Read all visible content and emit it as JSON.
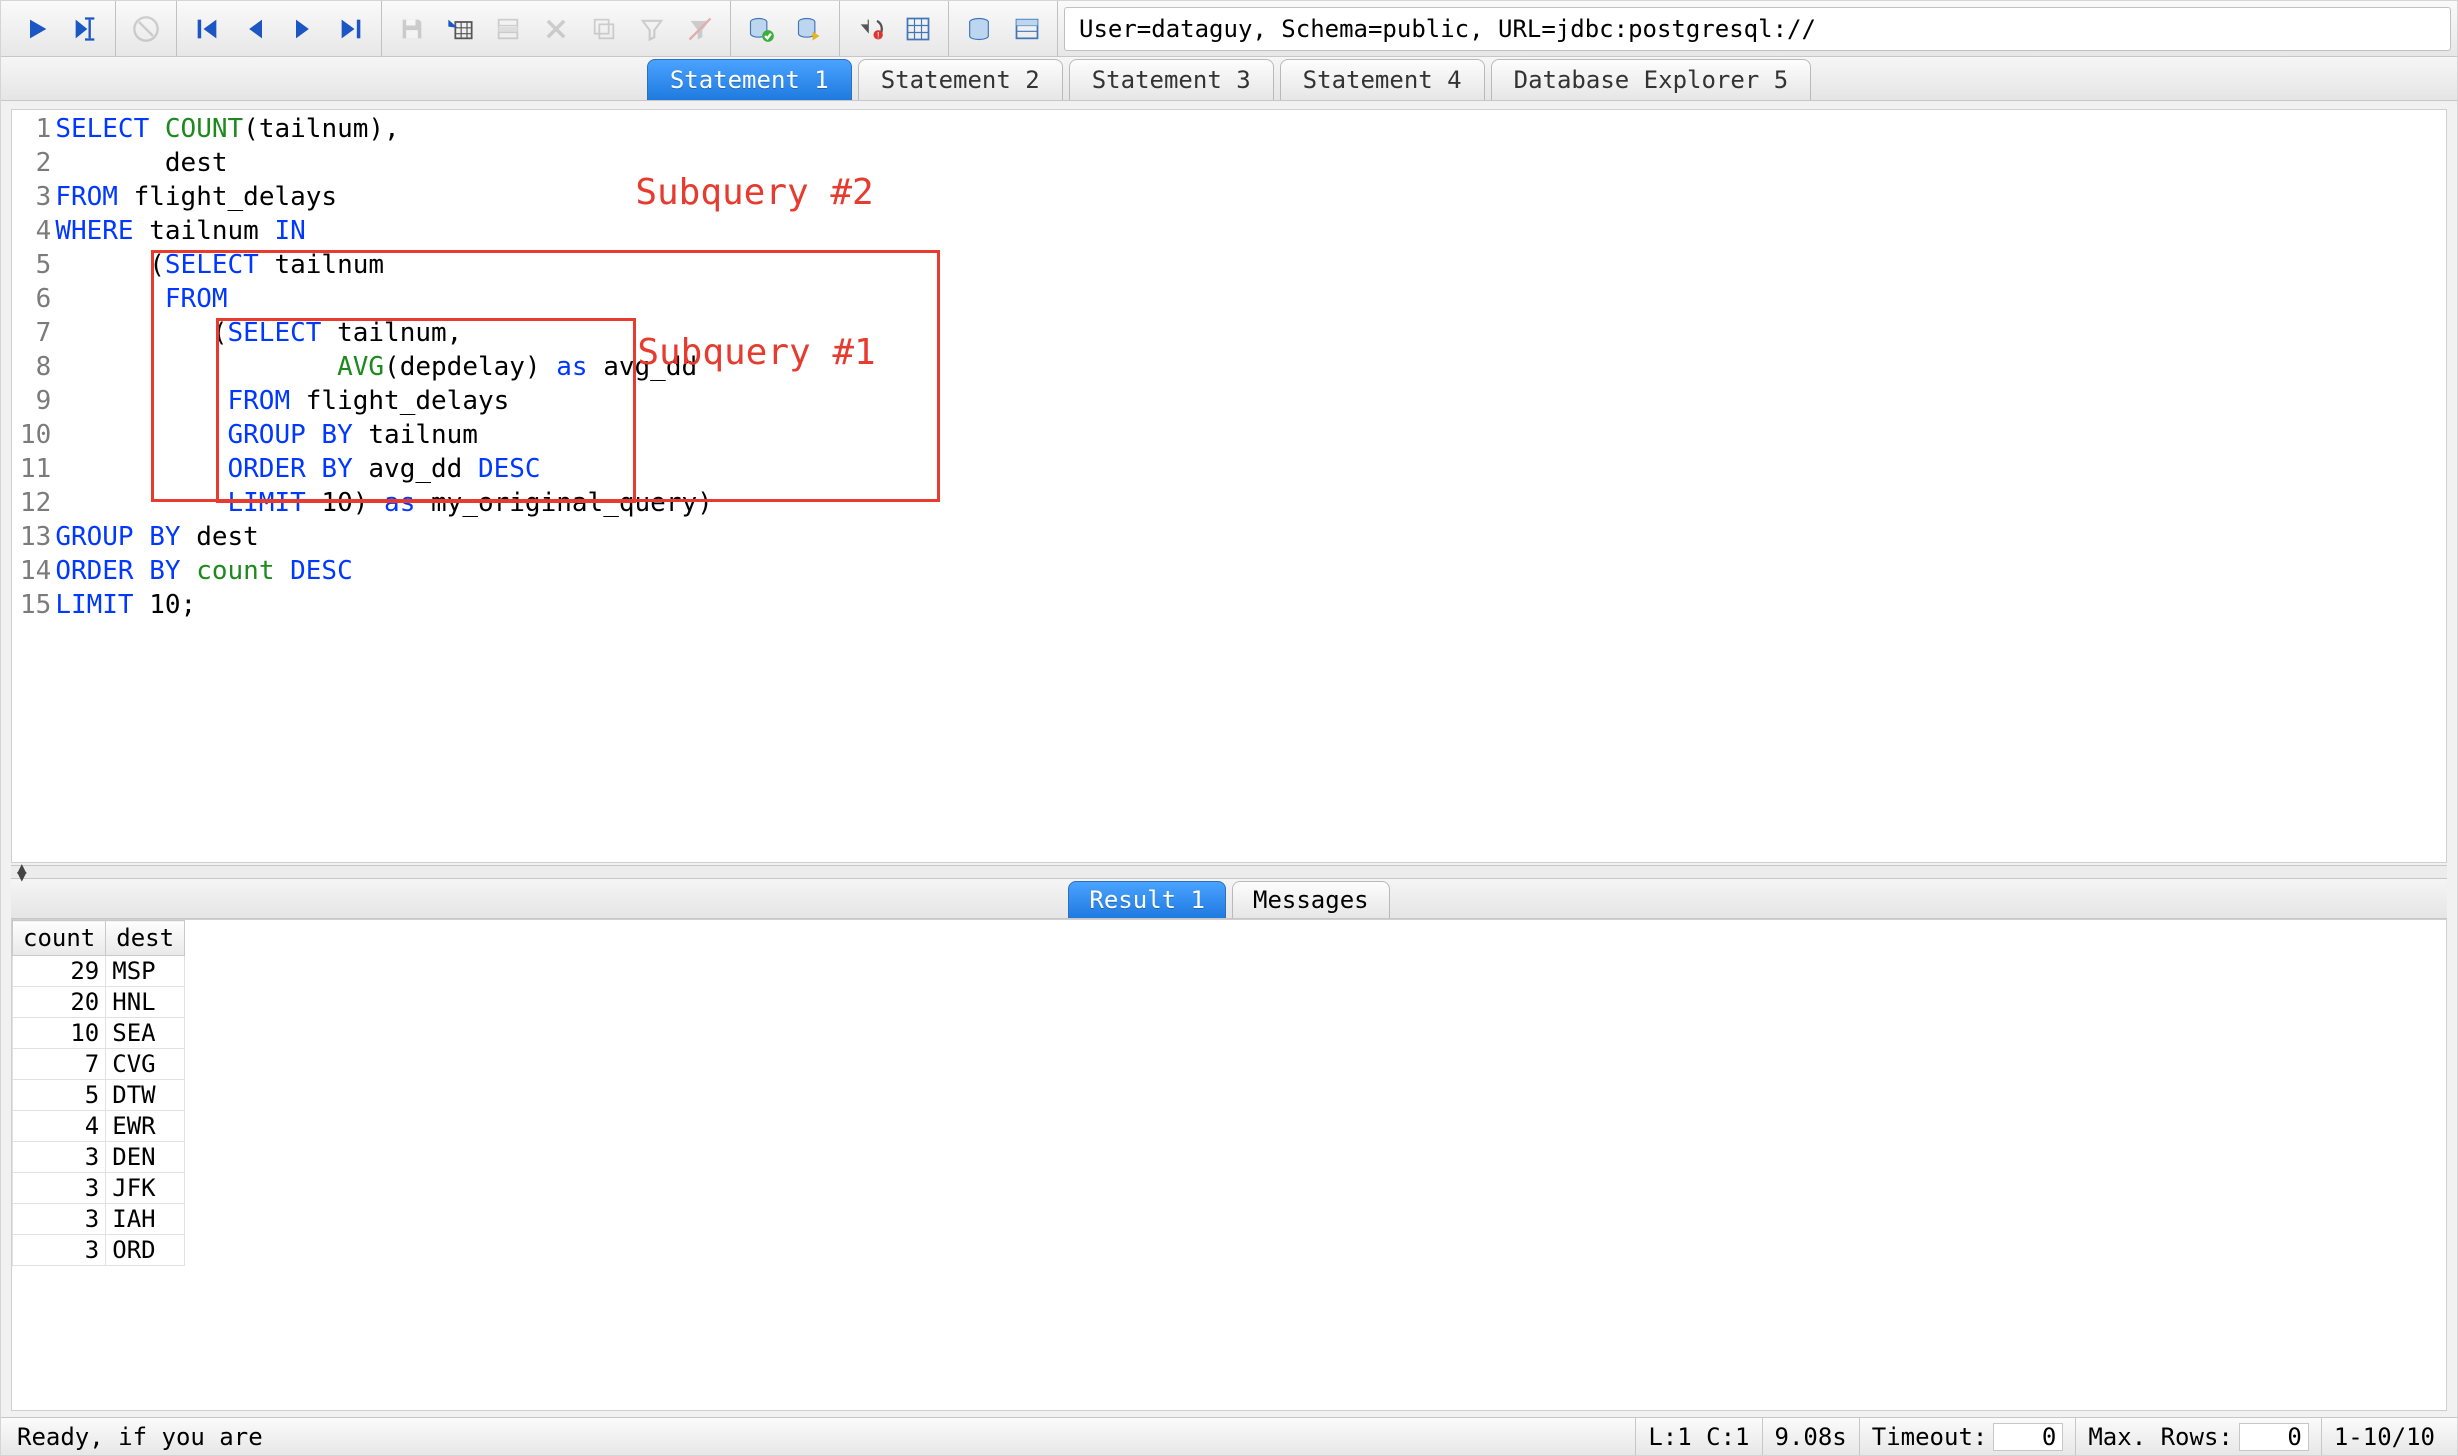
{
  "connection_info": "User=dataguy, Schema=public, URL=jdbc:postgresql://",
  "tabs": {
    "statements": [
      {
        "label": "Statement 1",
        "active": true
      },
      {
        "label": "Statement 2",
        "active": false
      },
      {
        "label": "Statement 3",
        "active": false
      },
      {
        "label": "Statement 4",
        "active": false
      },
      {
        "label": "Database Explorer 5",
        "active": false
      }
    ],
    "result_tabs": [
      {
        "label": "Result 1",
        "active": true
      },
      {
        "label": "Messages",
        "active": false
      }
    ]
  },
  "editor": {
    "line_count": 15,
    "lines": [
      [
        {
          "t": "SELECT ",
          "c": "kw"
        },
        {
          "t": "COUNT",
          "c": "fn"
        },
        {
          "t": "(tailnum),"
        }
      ],
      [
        {
          "t": "       dest"
        }
      ],
      [
        {
          "t": "FROM ",
          "c": "kw"
        },
        {
          "t": "flight_delays"
        }
      ],
      [
        {
          "t": "WHERE ",
          "c": "kw"
        },
        {
          "t": "tailnum "
        },
        {
          "t": "IN",
          "c": "kw"
        }
      ],
      [
        {
          "t": "      ("
        },
        {
          "t": "SELECT ",
          "c": "kw"
        },
        {
          "t": "tailnum"
        }
      ],
      [
        {
          "t": "       "
        },
        {
          "t": "FROM",
          "c": "kw"
        }
      ],
      [
        {
          "t": "          ("
        },
        {
          "t": "SELECT ",
          "c": "kw"
        },
        {
          "t": "tailnum,"
        }
      ],
      [
        {
          "t": "                  "
        },
        {
          "t": "AVG",
          "c": "fn"
        },
        {
          "t": "(depdelay) "
        },
        {
          "t": "as ",
          "c": "kw"
        },
        {
          "t": "avg_dd"
        }
      ],
      [
        {
          "t": "           "
        },
        {
          "t": "FROM ",
          "c": "kw"
        },
        {
          "t": "flight_delays"
        }
      ],
      [
        {
          "t": "           "
        },
        {
          "t": "GROUP BY ",
          "c": "kw"
        },
        {
          "t": "tailnum"
        }
      ],
      [
        {
          "t": "           "
        },
        {
          "t": "ORDER BY ",
          "c": "kw"
        },
        {
          "t": "avg_dd "
        },
        {
          "t": "DESC",
          "c": "kw"
        }
      ],
      [
        {
          "t": "           "
        },
        {
          "t": "LIMIT ",
          "c": "kw"
        },
        {
          "t": "10) "
        },
        {
          "t": "as ",
          "c": "kw"
        },
        {
          "t": "my_original_query)"
        }
      ],
      [
        {
          "t": "GROUP BY ",
          "c": "kw"
        },
        {
          "t": "dest"
        }
      ],
      [
        {
          "t": "ORDER BY ",
          "c": "kw"
        },
        {
          "t": "count ",
          "c": "fn"
        },
        {
          "t": "DESC",
          "c": "kw"
        }
      ],
      [
        {
          "t": "LIMIT ",
          "c": "kw"
        },
        {
          "t": "10;"
        }
      ]
    ]
  },
  "annotations": {
    "subquery2_label": "Subquery #2",
    "subquery1_label": "Subquery #1"
  },
  "results": {
    "columns": [
      "count",
      "dest"
    ],
    "rows": [
      {
        "count": 29,
        "dest": "MSP"
      },
      {
        "count": 20,
        "dest": "HNL"
      },
      {
        "count": 10,
        "dest": "SEA"
      },
      {
        "count": 7,
        "dest": "CVG"
      },
      {
        "count": 5,
        "dest": "DTW"
      },
      {
        "count": 4,
        "dest": "EWR"
      },
      {
        "count": 3,
        "dest": "DEN"
      },
      {
        "count": 3,
        "dest": "JFK"
      },
      {
        "count": 3,
        "dest": "IAH"
      },
      {
        "count": 3,
        "dest": "ORD"
      }
    ]
  },
  "status": {
    "message": "Ready, if you are",
    "cursor": "L:1 C:1",
    "exec_time": "9.08s",
    "timeout_label": "Timeout:",
    "timeout_value": "0",
    "maxrows_label": "Max. Rows:",
    "maxrows_value": "0",
    "range": "1-10/10"
  },
  "toolbar_icons": [
    "run-icon",
    "run-cursor-icon",
    "stop-icon",
    "first-icon",
    "prev-icon",
    "next-icon",
    "last-icon",
    "save-icon",
    "add-row-icon",
    "insert-row-icon",
    "delete-row-icon",
    "copy-row-icon",
    "filter-icon",
    "clear-filter-icon",
    "db-exec-icon",
    "db-script-icon",
    "db-rollback-icon",
    "db-columns-icon",
    "db-browse-icon",
    "db-result-icon"
  ]
}
